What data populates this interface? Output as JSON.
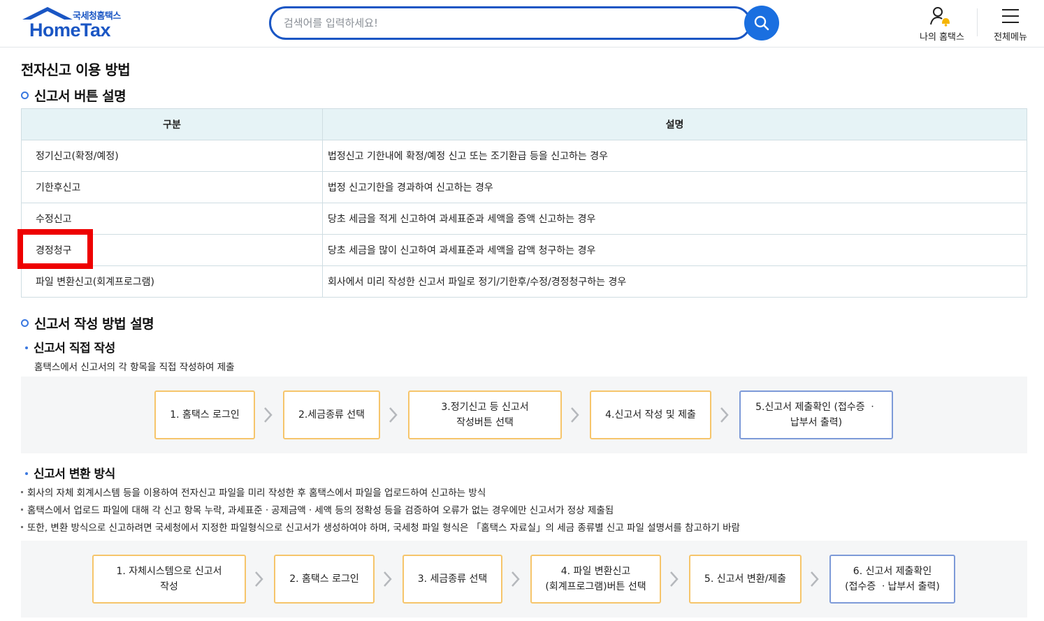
{
  "header": {
    "logo_small": "국세청홈택스",
    "logo_big": "HomeTax",
    "search_placeholder": "검색어를 입력하세요!",
    "my_hometax": "나의 홈택스",
    "all_menu": "전체메뉴"
  },
  "page_title": "전자신고 이용 방법",
  "section1": {
    "title": "신고서 버튼 설명",
    "headers": [
      "구분",
      "설명"
    ],
    "rows": [
      {
        "type": "정기신고(확정/예정)",
        "desc": "법정신고 기한내에 확정/예정 신고 또는 조기환급 등을 신고하는 경우"
      },
      {
        "type": "기한후신고",
        "desc": "법정 신고기한을 경과하여 신고하는 경우"
      },
      {
        "type": "수정신고",
        "desc": "당초 세금을 적게 신고하여 과세표준과 세액을 증액 신고하는 경우"
      },
      {
        "type": "경정청구",
        "desc": "당초 세금을 많이 신고하여 과세표준과 세액을 감액 청구하는 경우"
      },
      {
        "type": "파일 변환신고(회계프로그램)",
        "desc": "회사에서 미리 작성한 신고서 파일로 정기/기한후/수정/경정청구하는 경우"
      }
    ]
  },
  "section2": {
    "title": "신고서 작성 방법 설명",
    "direct": {
      "title": "신고서 직접 작성",
      "desc": "홈택스에서 신고서의 각 항목을 직접 작성하여 제출",
      "steps": [
        "1. 홈택스 로그인",
        "2.세금종류 선택",
        "3.정기신고 등 신고서\n작성버튼 선택",
        "4.신고서 작성 및 제출",
        "5.신고서 제출확인 (접수증 ㆍ\n납부서 출력)"
      ]
    },
    "convert": {
      "title": "신고서 변환 방식",
      "bullets": [
        "회사의 자체 회계시스템 등을 이용하여 전자신고 파일을 미리 작성한 후 홈택스에서 파일을 업로드하여 신고하는 방식",
        "홈택스에서 업로드 파일에 대해 각 신고 항목 누락, 과세표준ㆍ공제금액ㆍ세액 등의 정확성 등을 검증하여 오류가 없는 경우에만 신고서가 정상 제출됨",
        "또한, 변환 방식으로 신고하려면 국세청에서 지정한 파일형식으로 신고서가 생성하여야 하며, 국세청 파일 형식은 「홈택스 자료실」의 세금 종류별 신고 파일 설명서를 참고하기 바람"
      ],
      "steps": [
        "1. 자체시스템으로 신고서\n작성",
        "2. 홈택스 로그인",
        "3. 세금종류 선택",
        "4. 파일 변환신고\n(회계프로그램)버튼 선택",
        "5. 신고서 변환/제출",
        "6. 신고서 제출확인\n(접수증 ㆍ납부서 출력)"
      ]
    }
  },
  "colors": {
    "accent": "#1a56c4",
    "highlight": "#ee0000",
    "step_border": "#f6c56b",
    "final_step_border": "#7d9ad8"
  }
}
